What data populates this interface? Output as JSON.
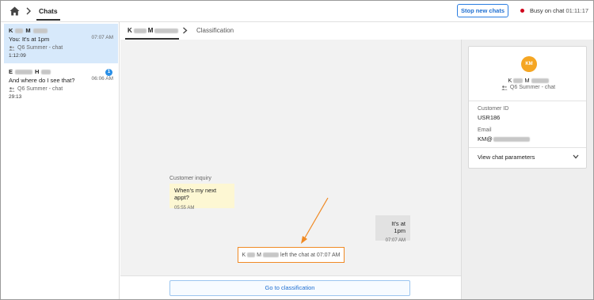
{
  "topbar": {
    "home_icon": "home-icon",
    "tab_label": "Chats",
    "stop_button": "Stop new chats",
    "status_label": "Busy on chat",
    "status_timer": "01:11:17",
    "status_color": "#d0021b"
  },
  "sidebar": {
    "conversations": [
      {
        "name_initial": "K",
        "name_initial2": "M",
        "message": "You: It's at 1pm",
        "time": "07:07 AM",
        "queue": "Q6 Summer - chat",
        "duration": "1:12:09",
        "active": true
      },
      {
        "name_initial": "E",
        "name_initial2": "H",
        "message": "And where do I see that?",
        "time": "06:06 AM",
        "badge": "1",
        "queue": "Q6 Summer - chat",
        "duration": "29:13",
        "active": false
      }
    ]
  },
  "center": {
    "tab_name_initial": "K",
    "tab_name_initial2": "M",
    "tab_classification": "Classification",
    "messages": {
      "inquiry_label": "Customer inquiry",
      "incoming_text": "When's my next appt?",
      "incoming_time": "05:55 AM",
      "outgoing_text": "It's at 1pm",
      "outgoing_time": "07:07 AM",
      "system_initial": "K",
      "system_initial2": "M",
      "system_text": "left the chat at 07:07 AM"
    },
    "bottom_button": "Go to classification",
    "highlight_color": "#f08a24"
  },
  "details": {
    "avatar_initials": "KM",
    "avatar_color": "#f5a623",
    "name_initial": "K",
    "name_initial2": "M",
    "queue": "Q6 Summer - chat",
    "customer_id_label": "Customer ID",
    "customer_id": "USR186",
    "email_label": "Email",
    "email_prefix": "KM@",
    "view_params": "View chat parameters"
  }
}
